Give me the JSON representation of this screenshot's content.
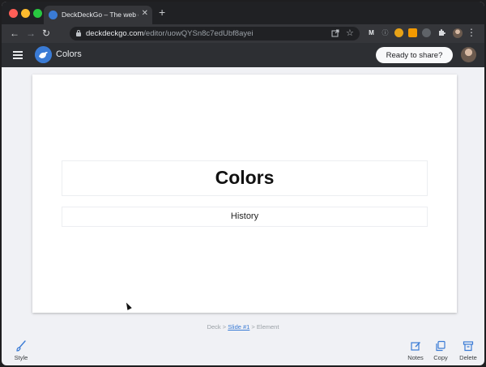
{
  "browser": {
    "tab_title": "DeckDeckGo – The web open source editor for presentations",
    "tab_close": "✕",
    "new_tab": "+",
    "nav_back": "←",
    "nav_forward": "→",
    "nav_reload": "↻",
    "nav_home": "⌂",
    "url_host": "deckdeckgo.com",
    "url_path": "/editor/uowQYSn8c7edUbf8ayei",
    "menu": "⋮",
    "extensions": [
      "M",
      "ⓘ",
      "▮",
      "◉",
      "●",
      "✦"
    ]
  },
  "app": {
    "title": "Colors",
    "share_label": "Ready to share?",
    "accent": "#3a7bd5",
    "header_bg": "#2d2f33"
  },
  "slide": {
    "title": "Colors",
    "content": "History"
  },
  "breadcrumb": {
    "deck": "Deck",
    "sep1": " > ",
    "slide": "Slide #1",
    "sep2": " > ",
    "element": "Element"
  },
  "actions": {
    "style": "Style",
    "notes": "Notes",
    "copy": "Copy",
    "delete": "Delete"
  }
}
